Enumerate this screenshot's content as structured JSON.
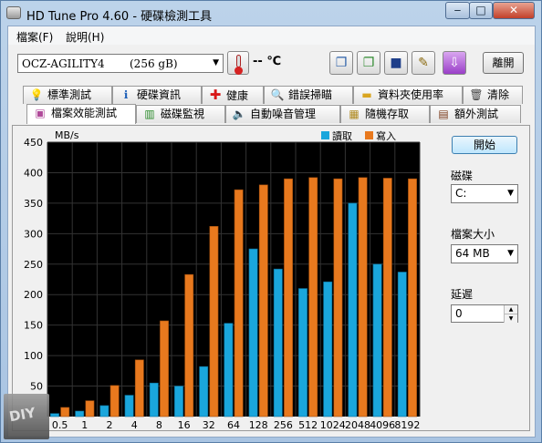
{
  "window": {
    "title": "HD Tune Pro 4.60 - 硬碟檢測工具"
  },
  "menu": {
    "file": "檔案(F)",
    "help": "說明(H)"
  },
  "toolbar": {
    "drive_name": "OCZ-AGILITY4",
    "drive_size": "(256 gB)",
    "temperature": "-- ℃",
    "exit_label": "離開"
  },
  "tabs_row1": [
    {
      "label": "標準測試",
      "icon": "bulb-icon"
    },
    {
      "label": "硬碟資訊",
      "icon": "info-icon"
    },
    {
      "label": "健康",
      "icon": "health-cross-icon"
    },
    {
      "label": "錯誤掃瞄",
      "icon": "magnifier-icon"
    },
    {
      "label": "資料夾使用率",
      "icon": "folder-icon"
    },
    {
      "label": "清除",
      "icon": "trash-icon"
    }
  ],
  "tabs_row2": [
    {
      "label": "檔案效能測試",
      "icon": "file-benchmark-icon",
      "active": true
    },
    {
      "label": "磁碟監視",
      "icon": "monitor-chart-icon"
    },
    {
      "label": "自動噪音管理",
      "icon": "speaker-icon"
    },
    {
      "label": "隨機存取",
      "icon": "random-access-icon"
    },
    {
      "label": "額外測試",
      "icon": "extra-tests-icon"
    }
  ],
  "side": {
    "start_label": "開始",
    "disk_label": "磁碟",
    "disk_value": "C:",
    "filesize_label": "檔案大小",
    "filesize_value": "64 MB",
    "delay_label": "延遲",
    "delay_value": "0"
  },
  "watermark_text": "DIY",
  "colors": {
    "read": "#1aa6dc",
    "write": "#e8791e",
    "plot_bg": "#000000"
  },
  "chart_data": {
    "type": "bar",
    "ylabel": "MB/s",
    "ylim": [
      0,
      450
    ],
    "yticks": [
      50,
      100,
      150,
      200,
      250,
      300,
      350,
      400,
      450
    ],
    "categories": [
      "0.5",
      "1",
      "2",
      "4",
      "8",
      "16",
      "32",
      "64",
      "128",
      "256",
      "512",
      "1024",
      "2048",
      "4096",
      "8192"
    ],
    "series": [
      {
        "name": "讀取",
        "values": [
          5,
          9,
          18,
          35,
          55,
          50,
          82,
          153,
          275,
          242,
          210,
          221,
          350,
          250,
          237
        ]
      },
      {
        "name": "寫入",
        "values": [
          15,
          26,
          51,
          93,
          157,
          233,
          312,
          372,
          380,
          390,
          392,
          390,
          392,
          391,
          390
        ]
      }
    ],
    "grid": true,
    "legend": "top-right"
  }
}
